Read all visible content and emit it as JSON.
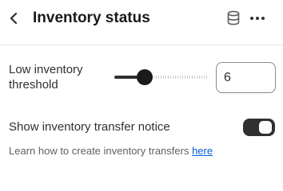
{
  "header": {
    "title": "Inventory status",
    "back_icon": "chevron-left-icon",
    "database_icon": "database-icon",
    "more_icon": "more-horizontal-icon"
  },
  "low_inventory": {
    "label": "Low inventory threshold",
    "value": "6",
    "slider_icon": "range-slider"
  },
  "transfer_notice": {
    "label": "Show inventory transfer notice",
    "enabled": true
  },
  "help": {
    "text": "Learn how to create inventory transfers ",
    "link_text": "here"
  },
  "colors": {
    "text": "#303030",
    "accent_dark": "#1a1a1a",
    "link": "#005bd3",
    "border": "#8a8a8a"
  }
}
